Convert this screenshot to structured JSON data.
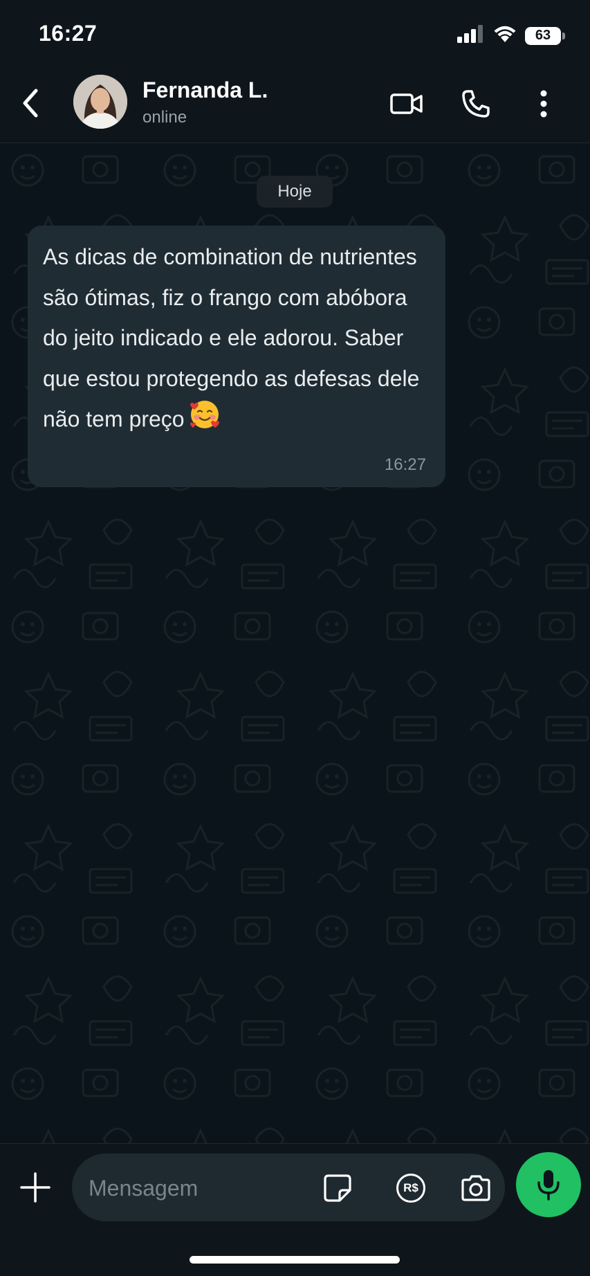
{
  "status_bar": {
    "time": "16:27",
    "battery_level": "63",
    "icons": [
      "cellular-signal-icon",
      "wifi-icon",
      "battery-icon"
    ]
  },
  "header": {
    "contact_name": "Fernanda L.",
    "contact_status": "online",
    "buttons": [
      "back-icon",
      "video-call-icon",
      "phone-icon",
      "more-options-icon"
    ]
  },
  "chat": {
    "date_label": "Hoje",
    "messages": [
      {
        "direction": "incoming",
        "text": "As dicas de combination de nutrientes são ótimas, fiz o frango com abóbora do jeito indicado e ele adorou. Saber que estou protegendo as defesas dele não tem preço",
        "emoji": "smiling-face-with-hearts",
        "time": "16:27"
      }
    ]
  },
  "composer": {
    "placeholder": "Mensagem",
    "value": "",
    "buttons": [
      "plus-icon",
      "sticker-icon",
      "payment-icon",
      "camera-icon",
      "microphone-icon"
    ],
    "payment_label": "R$"
  },
  "colors": {
    "background": "#0b141a",
    "header": "#0e161c",
    "bubble_incoming": "#202c33",
    "accent_green": "#21c063"
  }
}
